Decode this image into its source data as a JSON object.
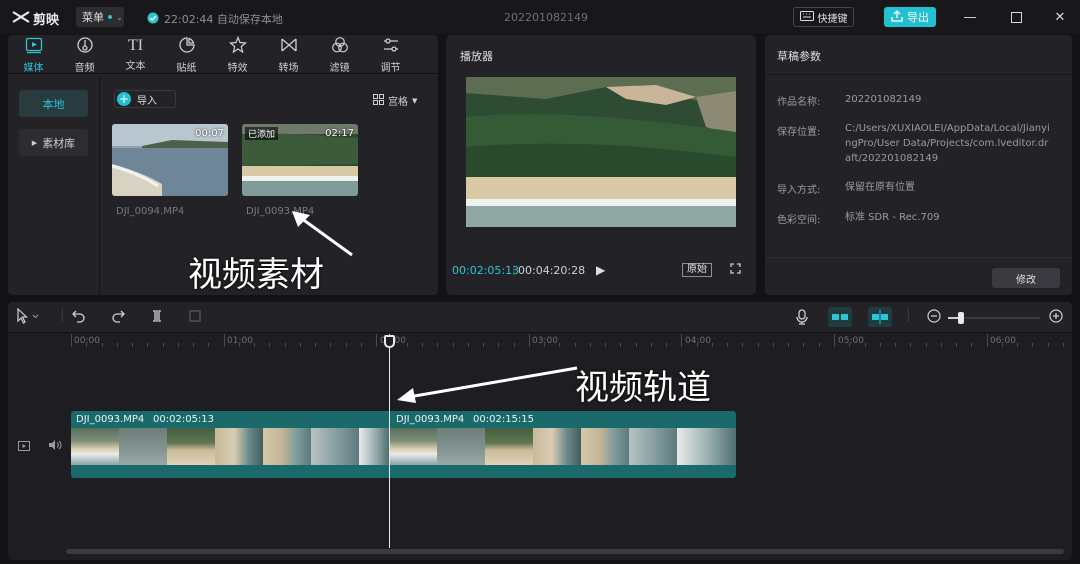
{
  "titlebar": {
    "app_name": "剪映",
    "menu_label": "菜单",
    "save_status": "22:02:44 自动保存本地",
    "project_title": "202201082149",
    "shortcut_label": "快捷键",
    "export_label": "导出"
  },
  "media_panel": {
    "tabs": [
      {
        "label": "媒体",
        "icon": "media-icon"
      },
      {
        "label": "音频",
        "icon": "audio-icon"
      },
      {
        "label": "文本",
        "icon": "text-icon"
      },
      {
        "label": "贴纸",
        "icon": "sticker-icon"
      },
      {
        "label": "特效",
        "icon": "effects-icon"
      },
      {
        "label": "转场",
        "icon": "transition-icon"
      },
      {
        "label": "滤镜",
        "icon": "filter-icon"
      },
      {
        "label": "调节",
        "icon": "adjust-icon"
      }
    ],
    "side_nav": [
      "本地",
      "素材库"
    ],
    "import_label": "导入",
    "view_label": "宫格",
    "clips": [
      {
        "name": "DJI_0094.MP4",
        "duration": "00:07",
        "added": ""
      },
      {
        "name": "DJI_0093.MP4",
        "duration": "02:17",
        "added": "已添加"
      }
    ],
    "annotation": "视频素材"
  },
  "player": {
    "title": "播放器",
    "current_time": "00:02:05:13",
    "total_time": "00:04:20:28",
    "ratio_label": "原始"
  },
  "draft": {
    "title": "草稿参数",
    "fields": [
      {
        "label": "作品名称:",
        "value": "202201082149"
      },
      {
        "label": "保存位置:",
        "value": "C:/Users/XUXIAOLEI/AppData/Local/JianyingPro/User Data/Projects/com.lveditor.draft/202201082149"
      },
      {
        "label": "导入方式:",
        "value": "保留在原有位置"
      },
      {
        "label": "色彩空间:",
        "value": "标准 SDR - Rec.709"
      }
    ],
    "edit_label": "修改"
  },
  "timeline": {
    "ruler": [
      "00:00",
      "01:00",
      "02:00",
      "03:00",
      "04:00",
      "05:00",
      "06:00"
    ],
    "clips": [
      {
        "name": "DJI_0093.MP4",
        "duration": "00:02:05:13"
      },
      {
        "name": "DJI_0093.MP4",
        "duration": "00:02:15:15"
      }
    ],
    "annotation": "视频轨道"
  },
  "colors": {
    "accent": "#23c0d2",
    "track": "#1b6a6b",
    "background": "#131316"
  }
}
